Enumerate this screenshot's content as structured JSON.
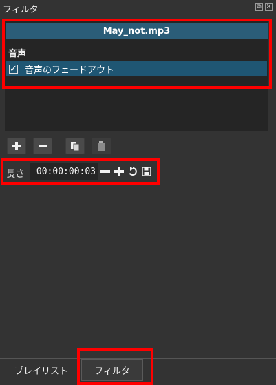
{
  "window": {
    "title": "フィルタ"
  },
  "filters": {
    "current_file": "May_not.mp3",
    "category": "音声",
    "items": [
      {
        "label": "音声のフェードアウト",
        "checked": true,
        "check_glyph": "✓"
      }
    ]
  },
  "toolbar": {
    "buttons": [
      {
        "name": "add-filter",
        "icon": "plus-icon"
      },
      {
        "name": "remove-filter",
        "icon": "minus-icon"
      },
      {
        "name": "copy-filter",
        "icon": "copy-icon"
      },
      {
        "name": "paste-filter",
        "icon": "paste-icon",
        "enabled": false
      }
    ]
  },
  "duration": {
    "label": "長さ",
    "value": "00:00:00:03"
  },
  "tabs": [
    {
      "label": "プレイリスト",
      "active": false
    },
    {
      "label": "フィルタ",
      "active": true
    }
  ],
  "colors": {
    "background": "#333333",
    "selection": "#1f5673",
    "header": "#2b5d78",
    "annotation": "#ff0000"
  }
}
